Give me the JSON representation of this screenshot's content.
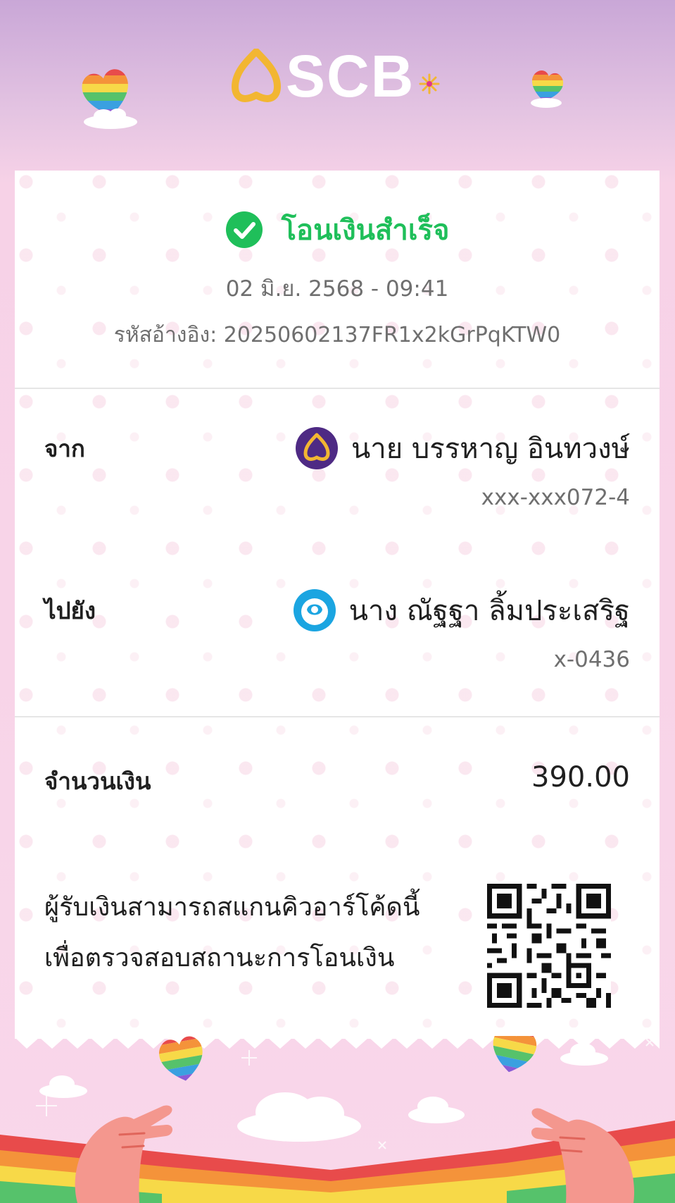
{
  "brand": {
    "name": "SCB"
  },
  "status": {
    "text": "โอนเงินสำเร็จ",
    "color": "#1fbf5a"
  },
  "transaction": {
    "datetime": "02 มิ.ย. 2568 - 09:41",
    "reference": "รหัสอ้างอิง: 20250602137FR1x2kGrPqKTW0"
  },
  "from": {
    "label": "จาก",
    "name": "นาย บรรหาญ อินทวงษ์",
    "account": "xxx-xxx072-4",
    "bank_icon": "scb-bank-icon"
  },
  "to": {
    "label": "ไปยัง",
    "name": "นาง ณัฐฐา ลิ้มประเสริฐ",
    "account": "x-0436",
    "bank_icon": "krungthai-bank-icon"
  },
  "amount": {
    "label": "จำนวนเงิน",
    "value": "390.00"
  },
  "verify_note": {
    "line1": "ผู้รับเงินสามารถสแกนคิวอาร์โค้ดนี้",
    "line2": "เพื่อตรวจสอบสถานะการโอนเงิน"
  },
  "colors": {
    "scb_purple": "#4e2a84",
    "scb_gold": "#f2b632",
    "ktb_blue": "#1ba5e1"
  }
}
